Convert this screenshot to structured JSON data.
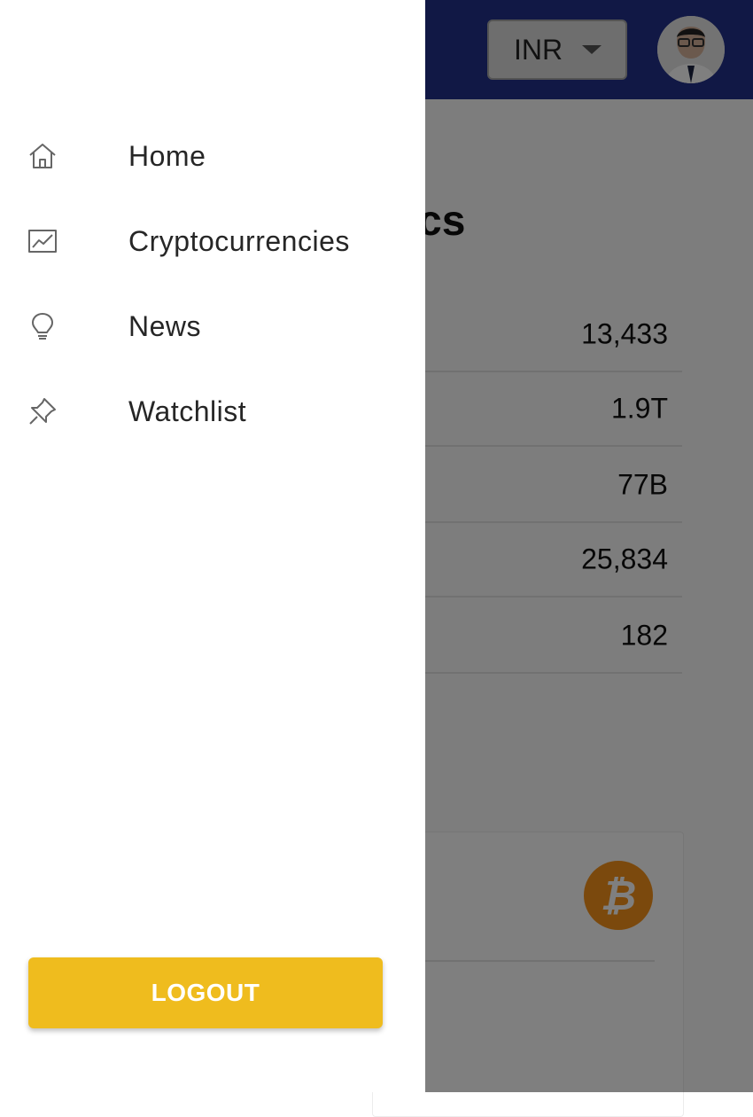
{
  "header": {
    "currency": {
      "selected": "INR"
    },
    "avatar_icon": "user-avatar-photo"
  },
  "main": {
    "section_title": "atistics",
    "stats": [
      {
        "value": "13,433"
      },
      {
        "value": "1.9T"
      },
      {
        "value": "77B"
      },
      {
        "value": "25,834"
      },
      {
        "value": "182"
      }
    ],
    "coin_card": {
      "icon": "bitcoin-icon",
      "icon_glyph": "₿"
    }
  },
  "drawer": {
    "items": [
      {
        "label": "Home",
        "icon": "home-icon"
      },
      {
        "label": "Cryptocurrencies",
        "icon": "line-chart-icon"
      },
      {
        "label": "News",
        "icon": "lightbulb-icon"
      },
      {
        "label": "Watchlist",
        "icon": "pushpin-icon"
      }
    ],
    "logout_label": "LOGOUT"
  },
  "colors": {
    "topbar": "#23318a",
    "accent_button": "#efbc1e",
    "bitcoin": "#f7931a",
    "overlay": "rgba(0,0,0,0.5)"
  }
}
